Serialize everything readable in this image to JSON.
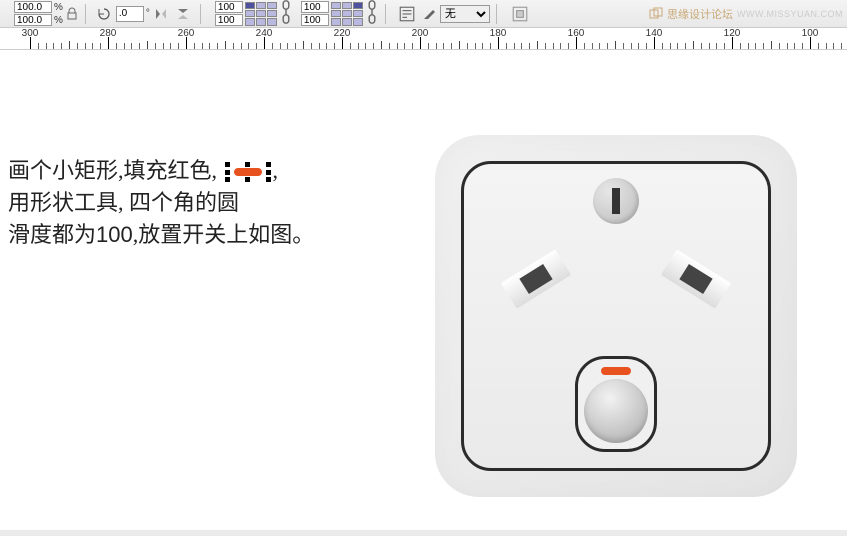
{
  "toolbar": {
    "scale_x": "100.0",
    "scale_y": "100.0",
    "pct_symbol": "%",
    "rotation": ".0",
    "deg_symbol": "°",
    "corner_tl": "100",
    "corner_bl": "100",
    "corner_tr": "100",
    "corner_br": "100",
    "outline_value": "无"
  },
  "watermark": {
    "text": "思缘设计论坛",
    "url": "WWW.MISSYUAN.COM"
  },
  "ruler": {
    "labels": [
      "300",
      "280",
      "260",
      "240",
      "220",
      "200",
      "180",
      "160",
      "140",
      "120",
      "100"
    ]
  },
  "instruction": {
    "line1_a": "画个小矩形,填充红色,",
    "line2": "用形状工具, 四个角的圆",
    "line3_a": "滑度都为",
    "line3_num": "100",
    "line3_b": ",放置开关上如图。"
  }
}
